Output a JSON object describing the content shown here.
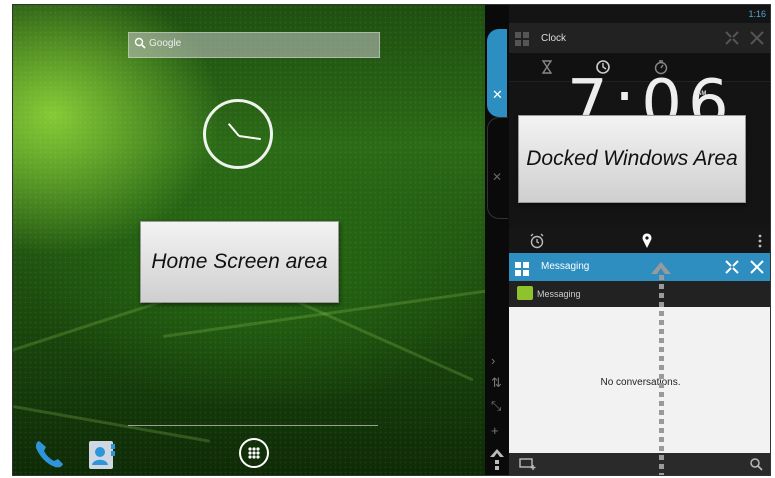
{
  "home": {
    "search_placeholder": "Google",
    "label": "Home Screen area",
    "dock": {
      "phone_icon": "phone-icon",
      "contacts_icon": "contacts-icon",
      "apps_icon": "all-apps-icon"
    }
  },
  "status_bar": {
    "time": "1:16"
  },
  "clock_window": {
    "title": "Clock",
    "time_display": "7:06",
    "ampm": "AM",
    "tabs": [
      "timer-icon",
      "clock-icon",
      "stopwatch-icon"
    ]
  },
  "docked": {
    "label": "Docked Windows Area"
  },
  "messaging_window": {
    "title": "Messaging",
    "subtitle": "Messaging",
    "empty_text": "No conversations."
  },
  "colors": {
    "accent": "#2f8ec0",
    "status": "#4fa8d0",
    "leaf_green": "#2c6a17"
  }
}
